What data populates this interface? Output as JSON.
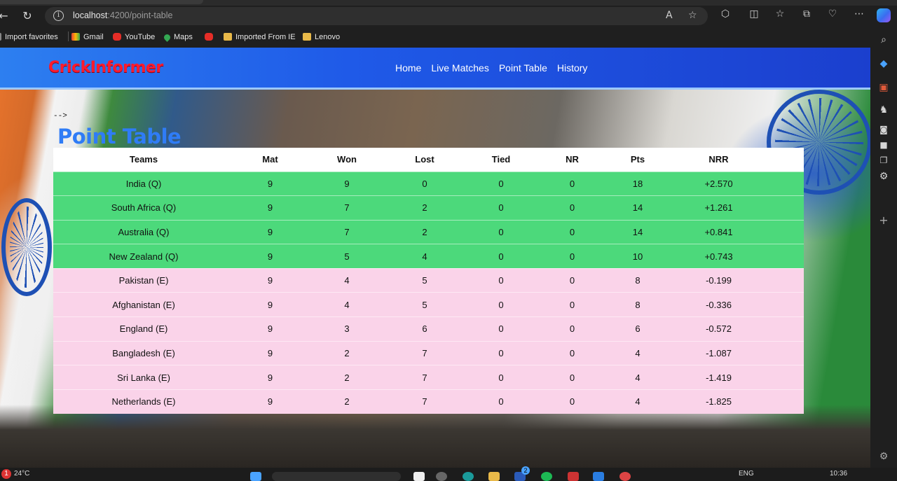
{
  "browser": {
    "url_host": "localhost",
    "url_path": ":4200/point-table",
    "favorites": [
      {
        "label": "Import favorites"
      },
      {
        "label": "Gmail"
      },
      {
        "label": "YouTube"
      },
      {
        "label": "Maps"
      },
      {
        "label": ""
      },
      {
        "label": "Imported From IE"
      },
      {
        "label": "Lenovo"
      }
    ]
  },
  "site": {
    "brand": "CrickInformer",
    "nav": [
      "Home",
      "Live Matches",
      "Point Table",
      "History"
    ],
    "comment": "-->",
    "page_title": "Point Table"
  },
  "table": {
    "headers": [
      "Teams",
      "Mat",
      "Won",
      "Lost",
      "Tied",
      "NR",
      "Pts",
      "NRR"
    ],
    "rows": [
      [
        "India (Q)",
        "9",
        "9",
        "0",
        "0",
        "0",
        "18",
        "+2.570"
      ],
      [
        "South Africa (Q)",
        "9",
        "7",
        "2",
        "0",
        "0",
        "14",
        "+1.261"
      ],
      [
        "Australia (Q)",
        "9",
        "7",
        "2",
        "0",
        "0",
        "14",
        "+0.841"
      ],
      [
        "New Zealand (Q)",
        "9",
        "5",
        "4",
        "0",
        "0",
        "10",
        "+0.743"
      ],
      [
        "Pakistan (E)",
        "9",
        "4",
        "5",
        "0",
        "0",
        "8",
        "-0.199"
      ],
      [
        "Afghanistan (E)",
        "9",
        "4",
        "5",
        "0",
        "0",
        "8",
        "-0.336"
      ],
      [
        "England (E)",
        "9",
        "3",
        "6",
        "0",
        "0",
        "6",
        "-0.572"
      ],
      [
        "Bangladesh (E)",
        "9",
        "2",
        "7",
        "0",
        "0",
        "4",
        "-1.087"
      ],
      [
        "Sri Lanka (E)",
        "9",
        "2",
        "7",
        "0",
        "0",
        "4",
        "-1.419"
      ],
      [
        "Netherlands (E)",
        "9",
        "2",
        "7",
        "0",
        "0",
        "4",
        "-1.825"
      ]
    ],
    "qualified_color": "#4cd97b",
    "eliminated_color": "#fad3e9"
  },
  "taskbar": {
    "weather": "24°C",
    "lang": "ENG",
    "time": "10:36",
    "badge": "2"
  }
}
